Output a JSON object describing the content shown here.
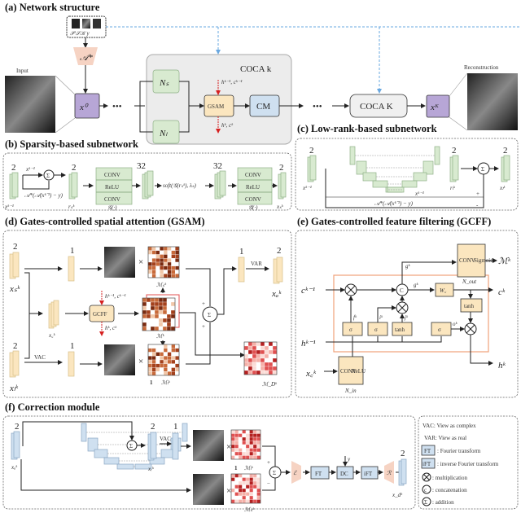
{
  "panel_a": {
    "title": "(a) Network structure",
    "input_label": "Input",
    "reconstruction_label": "Reconstruction",
    "operator": "𝒜*",
    "inputs_caption": "𝒫  𝒮𝒦  y",
    "x0": "x⁰",
    "dots": "•••",
    "coca_k": "COCA k",
    "ns": "Nₛ",
    "nl": "Nₗ",
    "gsam": "GSAM",
    "cm": "CM",
    "state_in": "hᵏ⁻¹, cᵏ⁻¹",
    "state_out": "hᵏ, cᵏ",
    "coca_K": "COCA K",
    "xK": "xᴷ"
  },
  "panel_b": {
    "title": "(b) Sparsity-based subnetwork",
    "ch_2a": "2",
    "ch_2b": "2",
    "ch_32a": "32",
    "ch_32b": "32",
    "ch_2c": "2",
    "x_prev": "xᵏ⁻¹",
    "x_prev_small": "xᵏ⁻¹",
    "residual": "𝒜*(𝒜(xᵏ⁻¹) − y)",
    "r_s": "rₛᵏ",
    "conv": "CONV",
    "relu": "ReLU",
    "g": "𝒢(·)",
    "g_tilde": "𝒢̃(·)",
    "soft": "soft(𝒢(rₛᵏ), λₛ)",
    "x_s": "xₛᵏ",
    "sigma": "Σ"
  },
  "panel_c": {
    "title": "(c) Low-rank-based subnetwork",
    "ch_a": "2",
    "ch_b": "2",
    "ch_c": "2",
    "x_prev": "xᵏ⁻¹",
    "x_prev_mid": "xᵏ⁻¹",
    "r_l": "rₗᵏ",
    "x_l": "xₗᵏ",
    "residual": "𝒜*(𝒜(xᵏ⁻¹) − y)",
    "plus": "+",
    "minus": "-",
    "sigma": "Σ"
  },
  "panel_d": {
    "title": "(d) Gates-controlled spatial attention (GSAM)",
    "ch_2a": "2",
    "ch_1a": "1",
    "ch_1b": "1",
    "ch_2b": "2",
    "ch_2c": "2",
    "ch_1c": "1",
    "x_s": "xₛᵏ",
    "x_c": "x꜀ᵏ",
    "x_l": "xₗᵏ",
    "x_a": "xₐᵏ",
    "gcff": "GCFF",
    "state_in": "hᵏ⁻¹, cᵏ⁻¹",
    "state_out": "hᵏ, cᵏ",
    "vac": "VAC",
    "var": "VAR",
    "times": "×",
    "m_s": "ℳₛᵏ",
    "m_k": "ℳᵏ",
    "m_l": "ℳₗᵏ",
    "m_d": "ℳ_Dᵏ",
    "one": "1",
    "plus": "+",
    "sigma": "Σ"
  },
  "panel_e": {
    "title": "(e) Gates-controlled feature filtering (GCFF)",
    "c_prev": "cᵏ⁻¹",
    "h_prev": "hᵏ⁻¹",
    "x_c": "x꜀ᵏ",
    "c_k": "cᵏ",
    "h_k": "hᵏ",
    "m_k": "ℳᵏ",
    "conv": "CONV",
    "sigmoid": "Sigmoid",
    "relu": "ReLU",
    "n_out": "N_out",
    "n_in": "N_in",
    "sigma": "σ",
    "tanh": "tanh",
    "w_c": "W꜀",
    "concat": "C",
    "f": "fᵏ",
    "i": "iᵏ",
    "j": "jᵏ",
    "o": "oᵏ",
    "g": "gᵏ",
    "g2": "gᵏ",
    "accent": "#f0a27a"
  },
  "panel_f": {
    "title": "(f) Correction module",
    "ch_2a": "2",
    "ch_2b": "2",
    "ch_1": "1",
    "ch_2c": "2",
    "x_a": "xₐᵏ",
    "x_r": "xᵣᵏ",
    "x_d": "x_dᵏ",
    "vac": "VAC",
    "times": "×",
    "one": "1",
    "m_l": "ℳₗᵏ",
    "m_s": "ℳₛᵏ",
    "enc": "ℰ",
    "ft": "FT",
    "dc": "DC",
    "ift": "iFT",
    "dec": "ℛ",
    "y": "y",
    "plus": "+",
    "minus": "−",
    "sigma": "Σ"
  },
  "legend": {
    "vac": "VAC: View as complex",
    "var": "VAR: View as real",
    "ft_box": "FT",
    "ft": ": Fourier transform",
    "ift_box": "iFT",
    "ift": ": inverse Fourier transform",
    "mult_sym": "⊗",
    "mult": ": multiplication",
    "concat_sym": "c",
    "concat": ": concatenation",
    "add_sym": "Σ",
    "add": ": addition"
  },
  "colors": {
    "green": "#d8ead0",
    "yellow": "#fbe6bf",
    "blue": "#cfe0f0",
    "purple": "#b7a6d6",
    "peach": "#f6d3c3",
    "dashed_blue": "#6aa8e0",
    "red_arrow": "#d62020"
  }
}
